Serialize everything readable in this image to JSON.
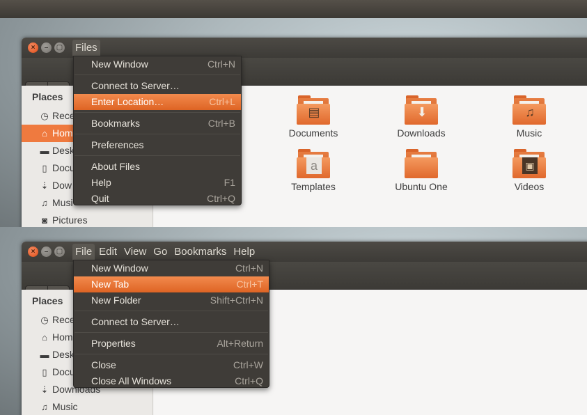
{
  "top": {
    "appmenu": "Files",
    "menu": {
      "items": [
        {
          "label": "New Window",
          "accel": "Ctrl+N"
        },
        {
          "label": "Connect to Server…",
          "accel": ""
        },
        {
          "label": "Enter Location…",
          "accel": "Ctrl+L"
        },
        {
          "label": "Bookmarks",
          "accel": "Ctrl+B"
        },
        {
          "label": "Preferences",
          "accel": ""
        },
        {
          "label": "About Files",
          "accel": ""
        },
        {
          "label": "Help",
          "accel": "F1"
        },
        {
          "label": "Quit",
          "accel": "Ctrl+Q"
        }
      ],
      "highlighted": "Enter Location…"
    },
    "sidebar": {
      "heading": "Places",
      "items": [
        {
          "label": "Rece",
          "icon": "clock-icon"
        },
        {
          "label": "Hom",
          "icon": "home-icon"
        },
        {
          "label": "Desk",
          "icon": "folder-icon"
        },
        {
          "label": "Docu",
          "icon": "document-icon"
        },
        {
          "label": "Dow",
          "icon": "download-icon"
        },
        {
          "label": "Musi",
          "icon": "music-icon"
        },
        {
          "label": "Pictures",
          "icon": "camera-icon"
        }
      ],
      "active": "Hom"
    },
    "folders": [
      {
        "label": "Documents",
        "glyph": "document"
      },
      {
        "label": "Downloads",
        "glyph": "download-arrow"
      },
      {
        "label": "Music",
        "glyph": "music-note"
      },
      {
        "label": "Templates",
        "glyph": "template"
      },
      {
        "label": "Ubuntu One",
        "glyph": "none"
      },
      {
        "label": "Videos",
        "glyph": "film"
      }
    ]
  },
  "bottom": {
    "menubar": [
      "File",
      "Edit",
      "View",
      "Go",
      "Bookmarks",
      "Help"
    ],
    "open_menu": "File",
    "menu": {
      "items": [
        {
          "label": "New Window",
          "accel": "Ctrl+N"
        },
        {
          "label": "New Tab",
          "accel": "Ctrl+T"
        },
        {
          "label": "New Folder",
          "accel": "Shift+Ctrl+N"
        },
        {
          "label": "Connect to Server…",
          "accel": ""
        },
        {
          "label": "Properties",
          "accel": "Alt+Return"
        },
        {
          "label": "Close",
          "accel": "Ctrl+W"
        },
        {
          "label": "Close All Windows",
          "accel": "Ctrl+Q"
        }
      ],
      "highlighted": "New Tab"
    },
    "sidebar": {
      "heading": "Places",
      "items": [
        {
          "label": "Rece",
          "icon": "clock-icon"
        },
        {
          "label": "Hom",
          "icon": "home-icon"
        },
        {
          "label": "Desk",
          "icon": "folder-icon"
        },
        {
          "label": "Docu",
          "icon": "document-icon"
        },
        {
          "label": "Downloads",
          "icon": "download-icon"
        },
        {
          "label": "Music",
          "icon": "music-icon"
        }
      ]
    }
  },
  "colors": {
    "accent": "#ef7a3f",
    "menu_bg": "#3f3c38",
    "titlebar": "#3d3b37"
  }
}
